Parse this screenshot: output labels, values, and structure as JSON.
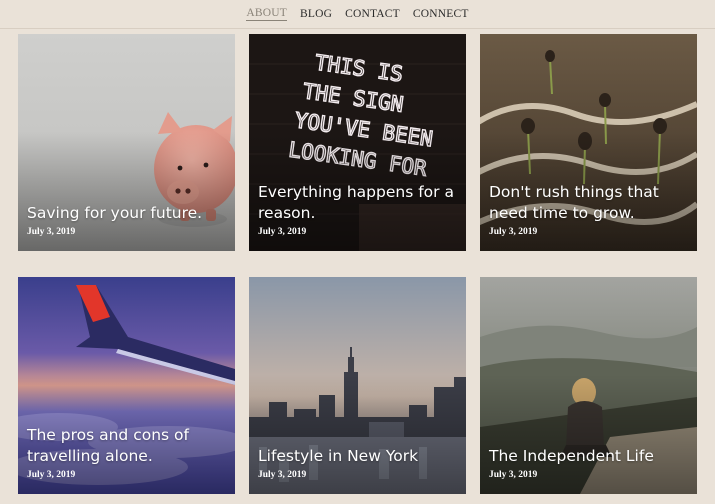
{
  "nav": {
    "items": [
      {
        "label": "ABOUT",
        "active": true
      },
      {
        "label": "BLOG"
      },
      {
        "label": "CONTACT"
      },
      {
        "label": "CONNECT"
      }
    ]
  },
  "posts": [
    {
      "title": "Saving for your future.",
      "date": "July 3, 2019",
      "image": "piggy-bank-icon"
    },
    {
      "title": "Everything happens for a reason.",
      "date": "July 3, 2019",
      "image": "neon-sign-icon",
      "neon_text": "THIS IS THE SIGN YOU'VE BEEN LOOKING FOR"
    },
    {
      "title": "Don't rush things that need time to grow.",
      "date": "July 3, 2019",
      "image": "seedlings-icon"
    },
    {
      "title": "The pros and cons of travelling alone.",
      "date": "July 3, 2019",
      "image": "airplane-wing-icon"
    },
    {
      "title": "Lifestyle in New York",
      "date": "July 3, 2019",
      "image": "city-skyline-icon"
    },
    {
      "title": "The Independent Life",
      "date": "July 3, 2019",
      "image": "mountain-view-icon"
    }
  ],
  "colors": {
    "page_background": "#eae2d8",
    "nav_active": "#8a8378",
    "card_text": "#ffffff"
  }
}
